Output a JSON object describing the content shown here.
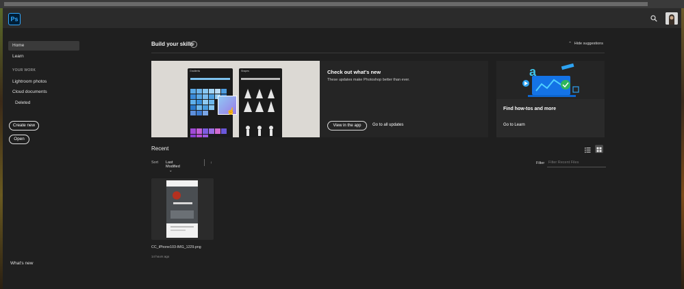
{
  "app": {
    "logo_text": "Ps"
  },
  "sidebar": {
    "home": "Home",
    "learn": "Learn",
    "section_label": "YOUR WORK",
    "lightroom": "Lightroom photos",
    "cloud_docs": "Cloud documents",
    "deleted": "Deleted",
    "create_new": "Create new",
    "open": "Open",
    "whats_new": "What's new"
  },
  "main": {
    "skills_title": "Build your skills",
    "hide_suggestions": "Hide suggestions",
    "card1": {
      "title": "Check out what's new",
      "description": "These updates make Photoshop better than ever.",
      "view_button": "View in the app",
      "updates_link": "Go to all updates",
      "panel_gradients": "Gradients",
      "panel_shapes": "Shapes"
    },
    "card2": {
      "title": "Find how-tos and more",
      "link": "Go to Learn"
    },
    "recent_title": "Recent",
    "sort_label": "Sort",
    "sort_value": "Last Modified",
    "filter_label": "Filter",
    "filter_placeholder": "Filter Recent Files",
    "file": {
      "name": "CC_iPhone103-IMG_1229.png",
      "time": "14 hours ago"
    }
  },
  "colors": {
    "accent": "#31a8ff",
    "background": "#1f1f1f",
    "card": "#252525"
  }
}
